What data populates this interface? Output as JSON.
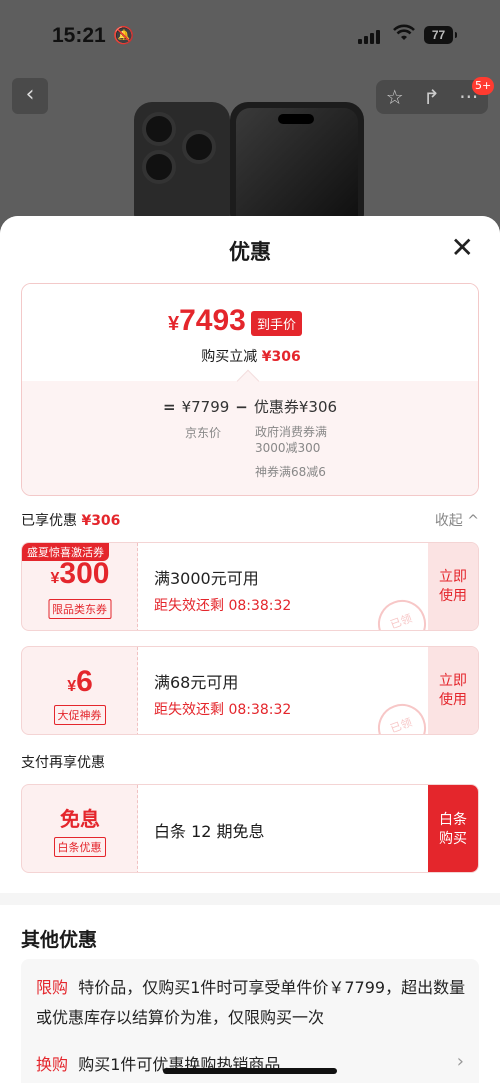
{
  "status": {
    "time": "15:21",
    "battery": "77"
  },
  "nav": {
    "back_icon": "‹",
    "badge": "5+"
  },
  "sheet": {
    "title": "优惠",
    "close": "✕"
  },
  "price_card": {
    "yen": "¥",
    "price": "7493",
    "tag": "到手价",
    "reduce_text": "购买立减",
    "reduce_amount": "¥306",
    "equals": "=",
    "jd_price": "¥7799",
    "minus": "−",
    "coupon_text": "优惠券¥306",
    "jd_label": "京东价",
    "gov_label_1": "政府消费券满",
    "gov_label_2": "3000减300",
    "god_label": "神券满68减6"
  },
  "enjoyed": {
    "label": "已享优惠",
    "amount": "¥306",
    "collapse": "收起 ^"
  },
  "coupons": [
    {
      "corner": "盛夏惊喜激活券",
      "yen": "¥",
      "amount": "300",
      "type": "限品类东券",
      "condition": "满3000元可用",
      "expire": "距失效还剩 08:38:32",
      "stamp": "已领",
      "action": "立即\n使用"
    },
    {
      "corner": "",
      "yen": "¥",
      "amount": "6",
      "type": "大促神券",
      "condition": "满68元可用",
      "expire": "距失效还剩 08:38:32",
      "stamp": "已领",
      "action": "立即\n使用"
    }
  ],
  "pay": {
    "title": "支付再享优惠",
    "free": "免息",
    "type": "白条优惠",
    "condition": "白条 12 期免息",
    "action": "白条\n购买"
  },
  "other": {
    "title": "其他优惠",
    "limit_tag": "限购",
    "limit_text": "特价品，仅购买1件时可享受单件价￥7799，超出数量或优惠库存以结算价为准，仅限购买一次",
    "swap_tag": "换购",
    "swap_text": "购买1件可优惠换购热销商品"
  }
}
